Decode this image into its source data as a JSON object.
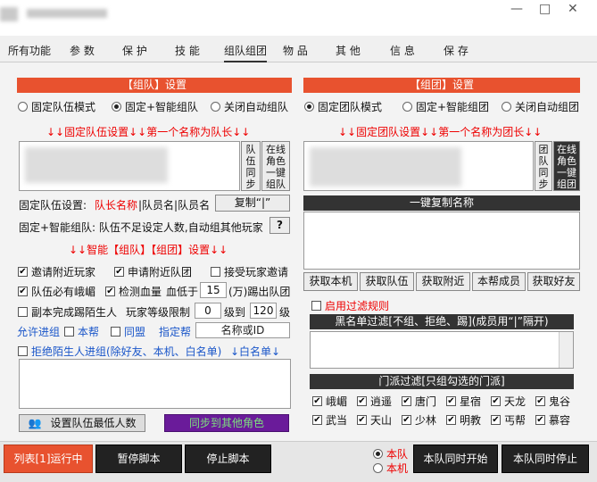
{
  "window": {
    "minimize": "—",
    "maximize": "□",
    "close": "✕"
  },
  "tabs": [
    "所有功能",
    "参 数",
    "保 护",
    "技 能",
    "组队组团",
    "物 品",
    "其 他",
    "信 息",
    "保 存"
  ],
  "left": {
    "header": "【组队】设置",
    "modes": [
      "固定队伍模式",
      "固定+智能组队",
      "关闭自动组队"
    ],
    "fixed_label": "↓↓固定队伍设置↓↓第一个名称为队长↓↓",
    "side_btn1": "队伍同步",
    "side_btn2": "在线角色一键组队",
    "fixed_set_prefix": "固定队伍设置:",
    "fixed_set_red": "队长名称",
    "fixed_set_suffix": "|队员名|队员名",
    "copy_btn": "复制“|”",
    "smart_note": "固定+智能组队: 队伍不足设定人数,自动组其他玩家",
    "help": "?",
    "smart_header": "↓↓智能【组队】【组团】设置↓↓",
    "row1": [
      "邀请附近玩家",
      "申请附近队团",
      "接受玩家邀请"
    ],
    "row2": [
      "队伍必有峨嵋",
      "检测血量"
    ],
    "hp_prefix": "血低于",
    "hp_value": "15",
    "hp_suffix": "(万)踢出队团",
    "row3_chk": "副本完成踢陌生人",
    "level_label": "玩家等级限制",
    "level_from": "0",
    "level_mid": "级到",
    "level_to": "120",
    "level_suffix": "级",
    "allow_label": "允许进组",
    "allow_opts": [
      "本帮",
      "同盟"
    ],
    "assign_label": "指定帮",
    "assign_placeholder": "名称或ID",
    "reject_label": "拒绝陌生人进组(除好友、本机、白名单)",
    "whitelist_label": "↓白名单↓",
    "set_min_btn": "设置队伍最低人数",
    "sync_btn": "同步到其他角色"
  },
  "right": {
    "header": "【组团】设置",
    "modes": [
      "固定团队模式",
      "固定+智能组团",
      "关闭自动组团"
    ],
    "fixed_label": "↓↓固定团队设置↓↓第一个名称为团长↓↓",
    "side_btn1": "团队同步",
    "side_btn2": "在线角色一键组团",
    "copy_header": "一键复制名称",
    "fetch_btns": [
      "获取本机",
      "获取队伍",
      "获取附近",
      "本帮成员",
      "获取好友"
    ],
    "filter_label": "启用过滤规则",
    "blacklist_header": "黑名单过滤[不组、拒绝、踢](成员用“|”隔开)",
    "sect_header": "门派过滤[只组勾选的门派]",
    "sects_row1": [
      "峨嵋",
      "逍遥",
      "唐门",
      "星宿",
      "天龙",
      "鬼谷"
    ],
    "sects_row2": [
      "武当",
      "天山",
      "少林",
      "明教",
      "丐帮",
      "慕容"
    ]
  },
  "bottom": {
    "list_btn": "列表[1]运行中",
    "pause_btn": "暂停脚本",
    "stop_btn": "停止脚本",
    "radio": [
      "本队",
      "本机"
    ],
    "start_btn": "本队同时开始",
    "stop_all_btn": "本队同时停止"
  },
  "colors": {
    "accent_red": "#e8522f",
    "dark": "#333333",
    "sync_purple": "#6a1b9a",
    "sync_text": "#7ee07e"
  }
}
